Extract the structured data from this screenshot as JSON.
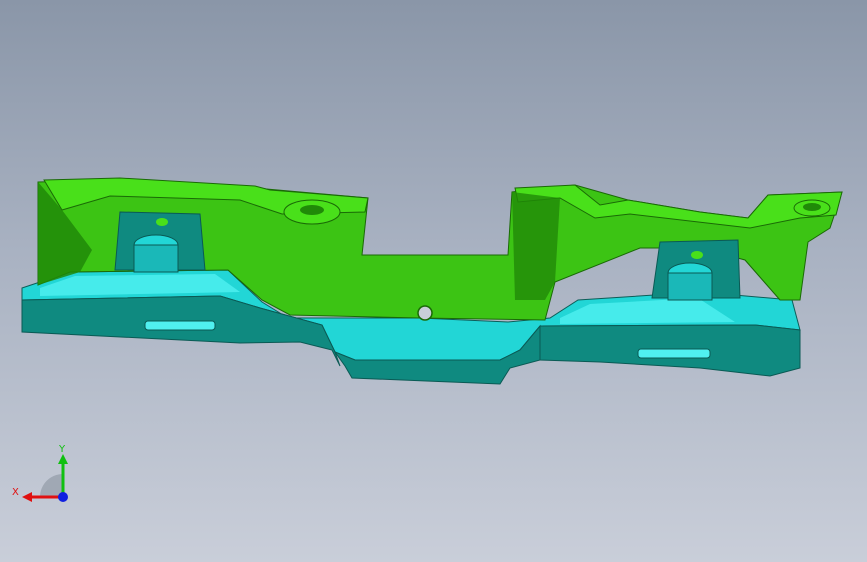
{
  "viewport": {
    "background_top": "#8a96a8",
    "background_bottom": "#c9ced9"
  },
  "model": {
    "name": "",
    "colors": {
      "green_top": "#49e01a",
      "green_face": "#3cc414",
      "green_dark": "#208a08",
      "cyan_top": "#22d6d6",
      "cyan_light": "#50f0f0",
      "teal_side": "#0f8a80",
      "teal_dark": "#0a6a62"
    }
  },
  "triad": {
    "x_label": "X",
    "y_label": "Y",
    "x_color": "#e01010",
    "y_color": "#10c010",
    "z_color": "#1020e0"
  }
}
